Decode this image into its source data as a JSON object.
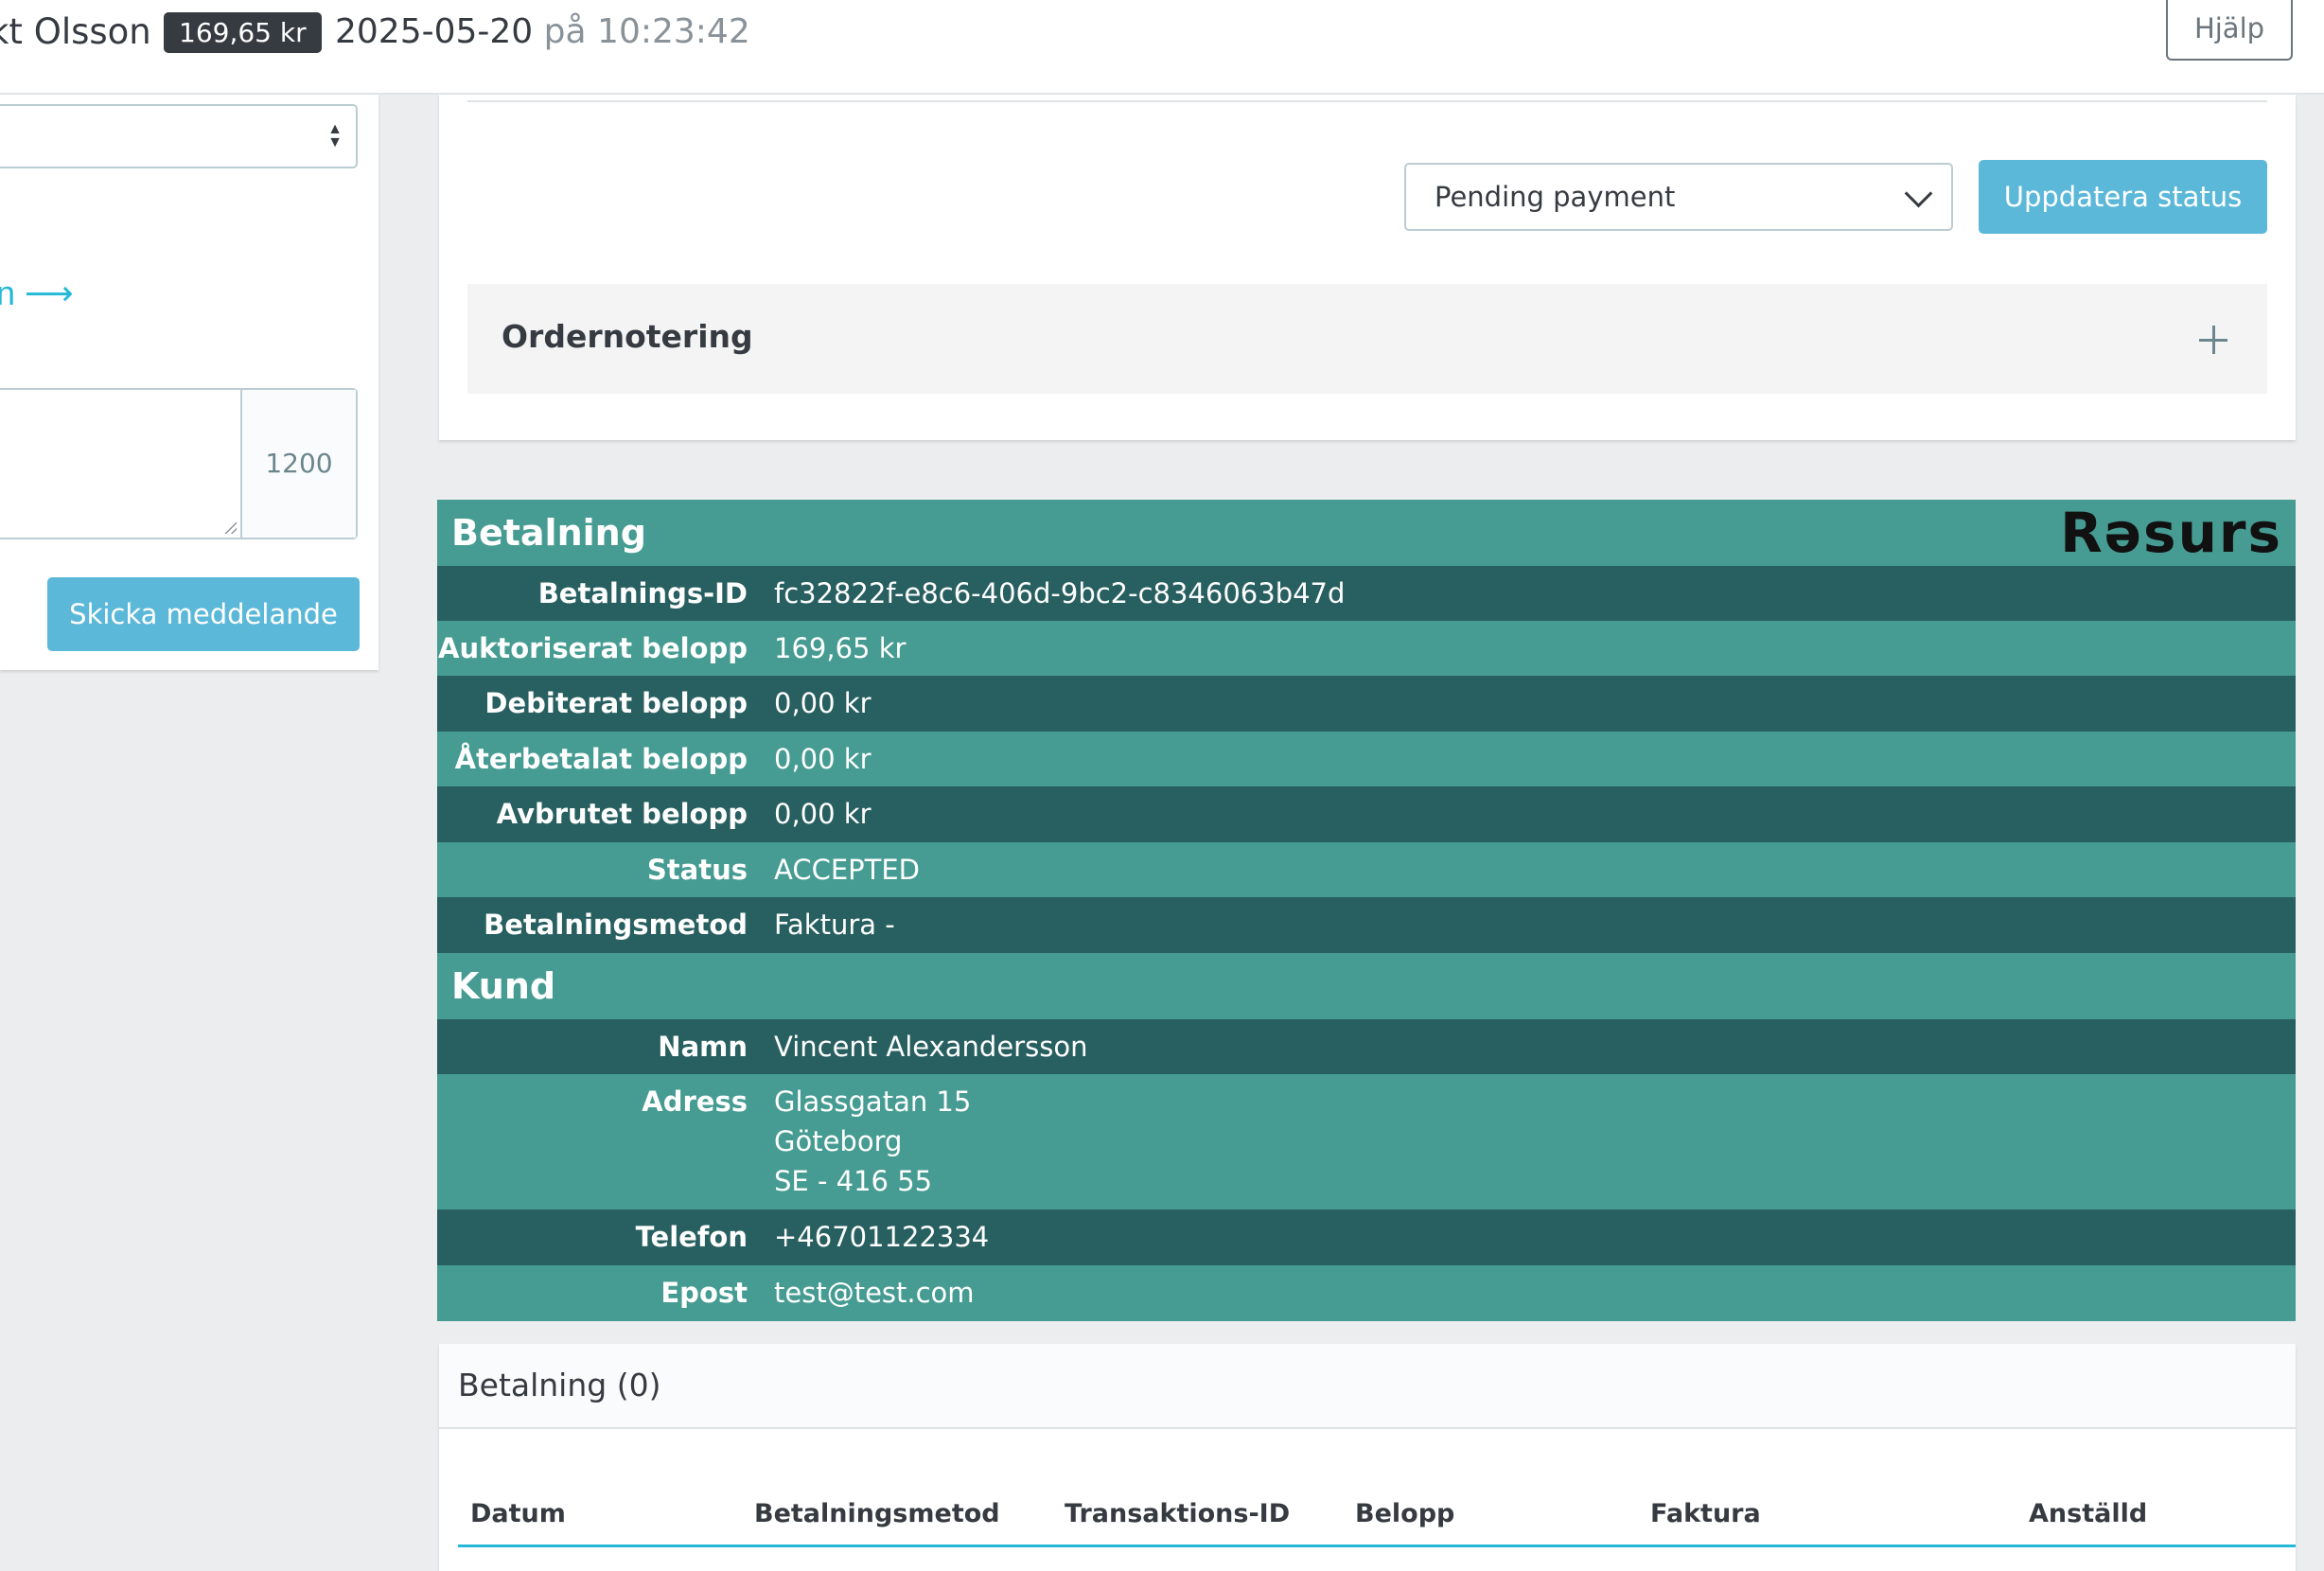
{
  "header": {
    "customer_name": "kt Olsson",
    "order_total": "169,65 kr",
    "order_date": "2025-05-20",
    "order_time_prefix": "på",
    "order_time": "10:23:42",
    "help_label": "Hjälp"
  },
  "left_panel": {
    "link_text": "n ⟶",
    "char_counter": "1200",
    "send_label": "Skicka meddelande"
  },
  "status_card": {
    "selected_status": "Pending payment",
    "update_label": "Uppdatera status",
    "order_note_title": "Ordernotering"
  },
  "resurs": {
    "logo": "Rəsurs",
    "payment_section": "Betalning",
    "payment_rows": [
      {
        "key": "Betalnings-ID",
        "value": "fc32822f-e8c6-406d-9bc2-c8346063b47d"
      },
      {
        "key": "Auktoriserat belopp",
        "value": "169,65 kr"
      },
      {
        "key": "Debiterat belopp",
        "value": "0,00 kr"
      },
      {
        "key": "Återbetalat belopp",
        "value": "0,00 kr"
      },
      {
        "key": "Avbrutet belopp",
        "value": "0,00 kr"
      },
      {
        "key": "Status",
        "value": "ACCEPTED"
      },
      {
        "key": "Betalningsmetod",
        "value": "Faktura -"
      }
    ],
    "customer_section": "Kund",
    "customer_rows": {
      "name_key": "Namn",
      "name": "Vincent Alexandersson",
      "address_key": "Adress",
      "address_line1": "Glassgatan 15",
      "address_line2": "Göteborg",
      "address_line3": "SE - 416 55",
      "phone_key": "Telefon",
      "phone": "+46701122334",
      "email_key": "Epost",
      "email": "test@test.com"
    }
  },
  "payments_card": {
    "title": "Betalning (0)",
    "columns": [
      "Datum",
      "Betalningsmetod",
      "Transaktions-ID",
      "Belopp",
      "Faktura",
      "Anställd"
    ]
  },
  "colors": {
    "teal_light": "#469c92",
    "teal_dark": "#285f60",
    "primary_button": "#5bb8d9",
    "badge_dark": "#363a41"
  }
}
